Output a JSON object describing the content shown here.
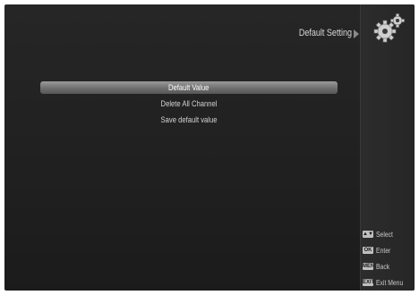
{
  "header": {
    "title": "Default Setting"
  },
  "menu": {
    "items": [
      {
        "label": "Default Value",
        "selected": true
      },
      {
        "label": "Delete All Channel",
        "selected": false
      },
      {
        "label": "Save default value",
        "selected": false
      }
    ]
  },
  "legend": [
    {
      "key": "▲▼",
      "label": "Select"
    },
    {
      "key": "OK",
      "label": "Enter"
    },
    {
      "key": "MENU",
      "label": "Back"
    },
    {
      "key": "EXIT",
      "label": "Exit Menu"
    }
  ],
  "icons": {
    "header": "gears-icon"
  },
  "colors": {
    "selected_bar": "#7a7a7a",
    "background": "#222222"
  }
}
